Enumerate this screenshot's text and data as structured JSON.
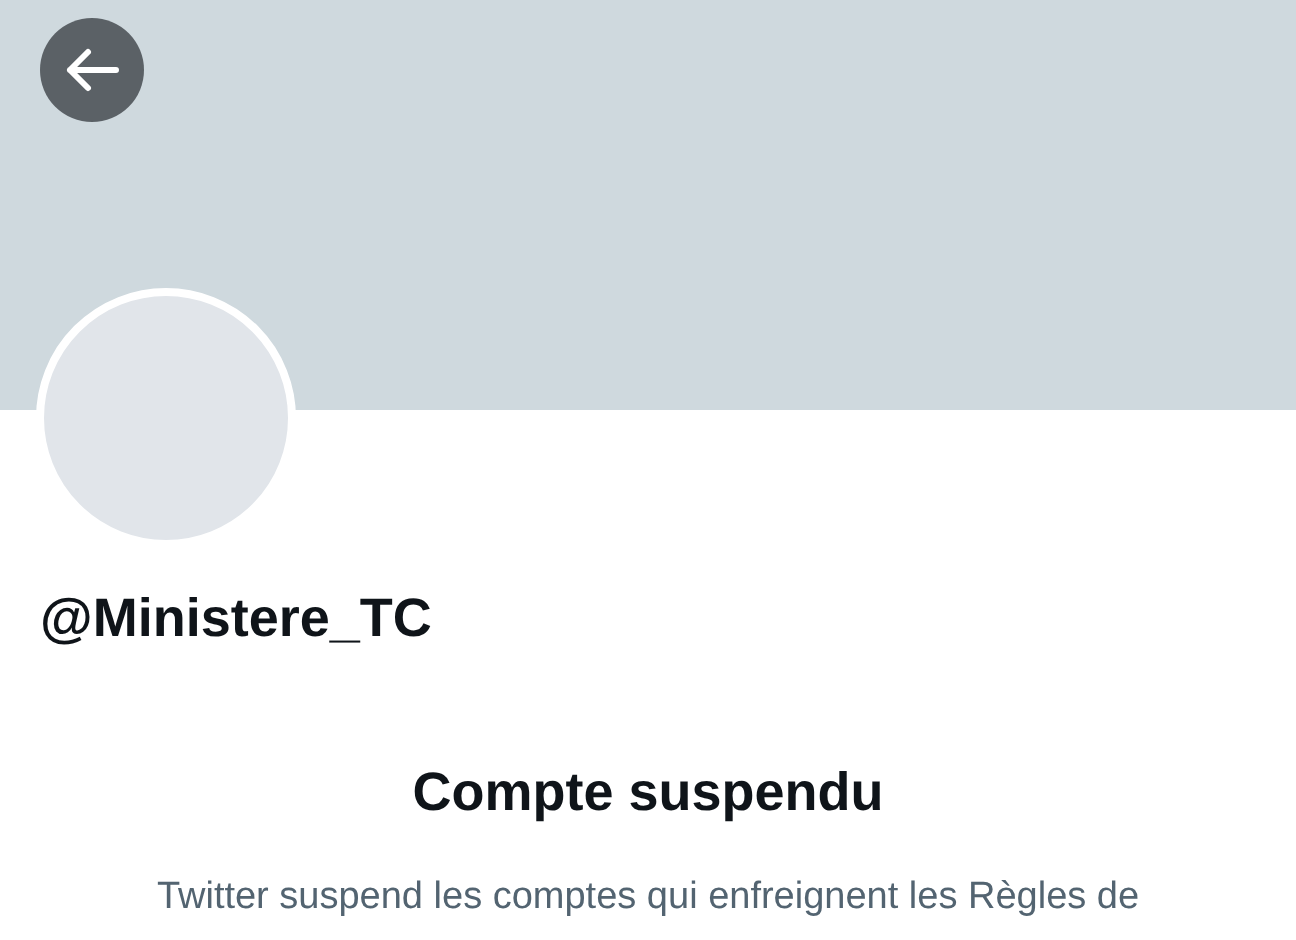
{
  "header": {
    "back_button": true
  },
  "profile": {
    "handle": "@Ministere_TC"
  },
  "notice": {
    "title": "Compte suspendu",
    "text": "Twitter suspend les comptes qui enfreignent les Règles de"
  }
}
